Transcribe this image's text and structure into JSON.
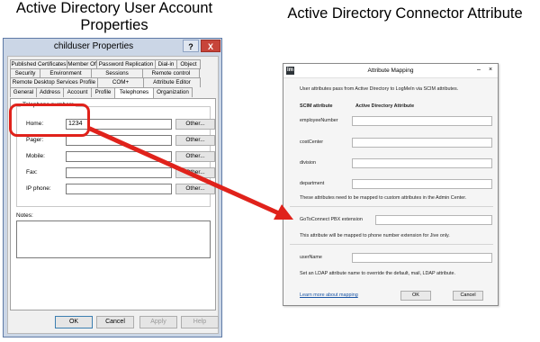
{
  "headings": {
    "left_line1": "Active Directory User Account",
    "left_line2": "Properties",
    "right": "Active Directory Connector Attribute"
  },
  "properties_dialog": {
    "title": "childuser Properties",
    "help_glyph": "?",
    "close_glyph": "X",
    "tabs_row1": [
      "Published Certificates",
      "Member Of",
      "Password Replication",
      "Dial-in",
      "Object"
    ],
    "tabs_row2": [
      "Security",
      "Environment",
      "Sessions",
      "Remote control"
    ],
    "tabs_row3": [
      "Remote Desktop Services Profile",
      "COM+",
      "Attribute Editor"
    ],
    "tabs_row4": [
      "General",
      "Address",
      "Account",
      "Profile",
      "Telephones",
      "Organization"
    ],
    "active_tab": "Telephones",
    "group_label": "Telephone numbers",
    "fields": [
      {
        "label": "Home:",
        "value": "1234",
        "other": "Other..."
      },
      {
        "label": "Pager:",
        "value": "",
        "other": "Other..."
      },
      {
        "label": "Mobile:",
        "value": "",
        "other": "Other..."
      },
      {
        "label": "Fax:",
        "value": "",
        "other": "Other..."
      },
      {
        "label": "IP phone:",
        "value": "",
        "other": "Other..."
      }
    ],
    "notes_label": "Notes:",
    "buttons": {
      "ok": "OK",
      "cancel": "Cancel",
      "apply": "Apply",
      "help": "Help"
    }
  },
  "attribute_mapping": {
    "app_icon": "lm",
    "title": "Attribute Mapping",
    "minimize_glyph": "–",
    "close_glyph": "×",
    "intro": "User attributes pass from Active Directory to LogMeIn via SCIM attributes.",
    "col_scim": "SCIM attribute",
    "col_ad": "Active Directory Attribute",
    "rows": [
      "employeeNumber",
      "costCenter",
      "division",
      "department"
    ],
    "custom_note": "These attributes need to be mapped to custom attributes in the Admin Center.",
    "extension_label": "GoToConnect PBX extension",
    "extension_note": "This attribute will be mapped to phone number extension for Jive only.",
    "username_label": "userName",
    "ldap_note": "Set an LDAP attribute name to override the default, mail, LDAP attribute.",
    "learn_more": "Learn more about mapping",
    "ok": "OK",
    "cancel": "Cancel"
  },
  "colors": {
    "annotation_red": "#e0221b",
    "window_frame": "#cbd6e6",
    "close_red": "#c7443a",
    "link_blue": "#1a55a5"
  }
}
